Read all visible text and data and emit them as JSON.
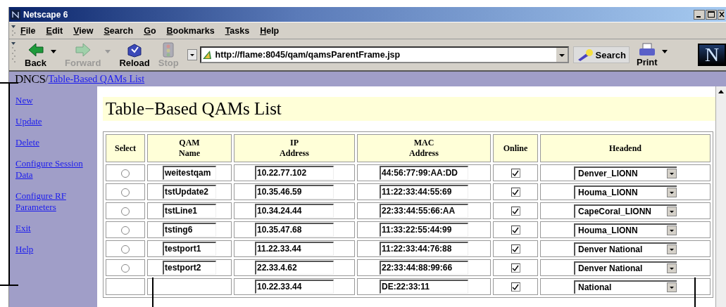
{
  "window": {
    "title": "Netscape 6"
  },
  "menu": [
    "File",
    "Edit",
    "View",
    "Search",
    "Go",
    "Bookmarks",
    "Tasks",
    "Help"
  ],
  "toolbar": [
    {
      "label": "Back",
      "kind": "back",
      "disabled": false
    },
    {
      "label": "Forward",
      "kind": "forward",
      "disabled": true
    },
    {
      "label": "Reload",
      "kind": "reload",
      "disabled": false
    },
    {
      "label": "Stop",
      "kind": "stop",
      "disabled": true
    }
  ],
  "address": {
    "value": "http://flame:8045/qam/qamsParentFrame.jsp"
  },
  "search_button": "Search",
  "print_button": "Print",
  "logo": "N",
  "breadcrumb": {
    "root": "DNCS",
    "separator": "/",
    "link": "Table-Based QAMs List"
  },
  "sidebar": {
    "items": [
      "New",
      "Update",
      "Delete",
      "Configure Session Data",
      "Configure RF Parameters",
      "Exit",
      "Help"
    ]
  },
  "page_title": "Table−Based QAMs List",
  "table": {
    "columns": [
      {
        "lines": [
          "Select"
        ]
      },
      {
        "lines": [
          "QAM",
          "Name"
        ]
      },
      {
        "lines": [
          "IP",
          "Address"
        ]
      },
      {
        "lines": [
          "MAC",
          "Address"
        ]
      },
      {
        "lines": [
          "Online"
        ]
      },
      {
        "lines": [
          "Headend"
        ]
      }
    ],
    "rows": [
      {
        "selected": false,
        "name": "weitestqam",
        "ip": "10.22.77.102",
        "mac": "44:56:77:99:AA:DD",
        "online": true,
        "headend": "Denver_LIONN"
      },
      {
        "selected": false,
        "name": "tstUpdate2",
        "ip": "10.35.46.59",
        "mac": "11:22:33:44:55:69",
        "online": true,
        "headend": "Houma_LIONN"
      },
      {
        "selected": false,
        "name": "tstLine1",
        "ip": "10.34.24.44",
        "mac": "22:33:44:55:66:AA",
        "online": true,
        "headend": "CapeCoral_LIONN"
      },
      {
        "selected": false,
        "name": "tsting6",
        "ip": "10.35.47.68",
        "mac": "11:33:22:55:44:99",
        "online": true,
        "headend": "Houma_LIONN"
      },
      {
        "selected": false,
        "name": "testport1",
        "ip": "11.22.33.44",
        "mac": "11:22:33:44:76:88",
        "online": true,
        "headend": "Denver National"
      },
      {
        "selected": false,
        "name": "testport2",
        "ip": "22.33.4.62",
        "mac": "22:33:44:88:99:66",
        "online": true,
        "headend": "Denver National"
      },
      {
        "ip": "10.22.33.44",
        "mac": "DE:22:33:11",
        "online": true,
        "headend": "National"
      }
    ]
  }
}
